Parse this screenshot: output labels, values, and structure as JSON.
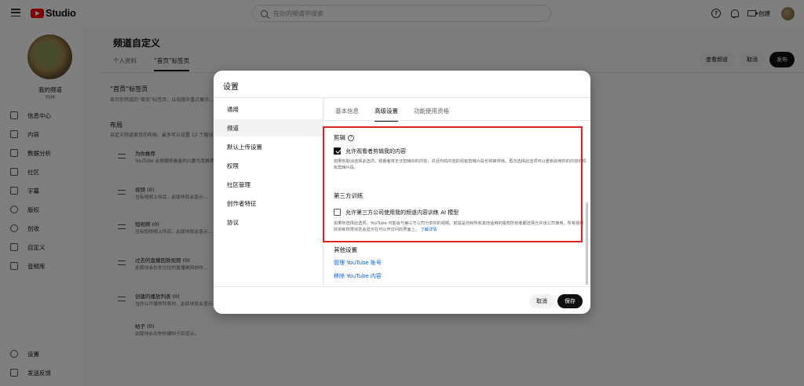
{
  "topbar": {
    "logo_text": "Studio",
    "search_placeholder": "在你的频道中搜索",
    "help_glyph": "?",
    "create_label": "创建"
  },
  "sidebar": {
    "channel_name": "我的频道",
    "channel_sub": "码林",
    "items": [
      {
        "label": "信息中心",
        "icon": "dashboard-icon"
      },
      {
        "label": "内容",
        "icon": "content-icon"
      },
      {
        "label": "数据分析",
        "icon": "analytics-icon"
      },
      {
        "label": "社区",
        "icon": "community-icon"
      },
      {
        "label": "字幕",
        "icon": "subtitles-icon"
      },
      {
        "label": "版权",
        "icon": "copyright-icon"
      },
      {
        "label": "创收",
        "icon": "earn-icon"
      },
      {
        "label": "自定义",
        "icon": "customization-icon"
      },
      {
        "label": "音频库",
        "icon": "audio-library-icon"
      }
    ],
    "bottom_items": [
      {
        "label": "设置",
        "icon": "settings-icon"
      },
      {
        "label": "发送反馈",
        "icon": "feedback-icon"
      }
    ]
  },
  "page": {
    "title": "频道自定义",
    "tabs": [
      "个人资料",
      "“首页”标签页"
    ],
    "active_tab": 1,
    "actions": {
      "view_channel": "查看频道",
      "cancel": "取消",
      "publish": "发布"
    },
    "home_section_title": "“首页”标签页",
    "home_section_desc": "显示你频道的“首页”标签页，以向观众重点展示...",
    "layout_title": "布局",
    "layout_desc": "自定义频道首页的布局，最多可以设置 12 个版块",
    "rows": [
      {
        "title": "为你推荐",
        "desc": "YouTube 会根据观看者的兴趣为其推荐..."
      },
      {
        "title": "视频 (0)",
        "desc": "当有视频上传后，此版块就会显示..."
      },
      {
        "title": "短视频 (0)",
        "desc": "当有短视频上传后，此版块就会显示..."
      },
      {
        "title": "过去的直播回放视频 (0)",
        "desc": "此版块会在你过往的直播被回放时..."
      },
      {
        "title": "创建的播放列表 (0)",
        "desc": "当你公开播放列表时，此版块就会显示..."
      },
      {
        "title": "帖子 (0)",
        "desc": "此版块会在你创建帖子后显示。"
      }
    ]
  },
  "dialog": {
    "title": "设置",
    "nav": [
      "通用",
      "频道",
      "默认上传设置",
      "权限",
      "社区管理",
      "创作者特征",
      "协议"
    ],
    "active_nav": 1,
    "tabs": [
      "基本信息",
      "高级设置",
      "功能使用资格"
    ],
    "active_tab": 1,
    "remix": {
      "heading": "剪辑",
      "checkbox_label": "允许观看者剪辑我的内容",
      "checked": true,
      "description": "如果你取消选择此选项，观看者将无法剪辑你的内容，并且你的内容的现有剪辑片段也将被停用。再次选择此选项可以重新启用你的内容的现有剪辑片段。"
    },
    "third_party": {
      "heading": "第三方训练",
      "checkbox_label": "允许第三方公司使用我的频道内容训练 AI 模型",
      "checked": false,
      "description": "如果你选择此选项，YouTube 可能会与第三方公司分享你的视频。前提是你和所有其他适用的版权所有者都选择允许该公司使用。所有视频的训练权限状态会显示在可公开访问的界面上。",
      "link": "了解详情"
    },
    "other": {
      "heading": "其他设置",
      "links": [
        "管理 YouTube 账号",
        "移除 YouTube 内容"
      ]
    },
    "buttons": {
      "cancel": "取消",
      "save": "保存"
    }
  },
  "colors": {
    "highlight_border": "#e02020",
    "link": "#065fd4",
    "brand_red": "#ff0000"
  }
}
